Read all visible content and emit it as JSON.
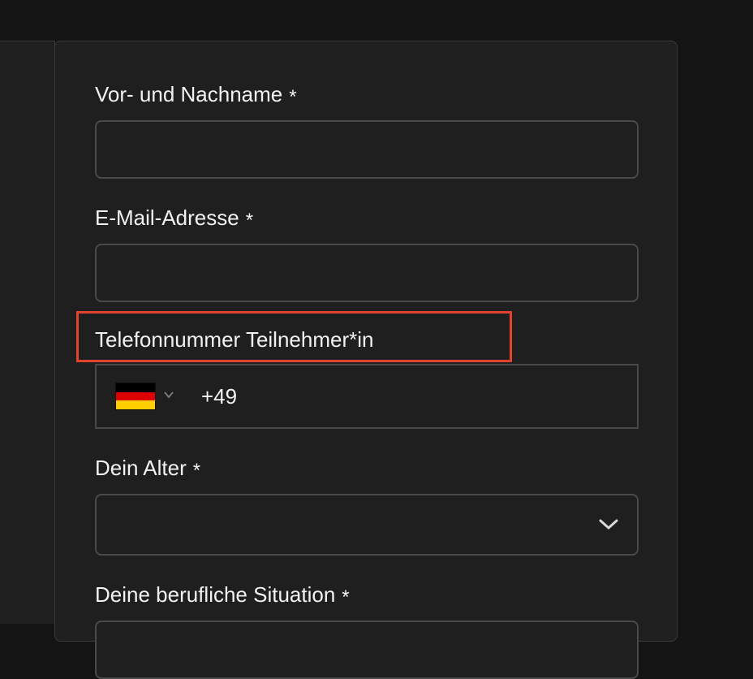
{
  "form": {
    "full_name": {
      "label": "Vor- und Nachname",
      "required_mark": "*",
      "value": ""
    },
    "email": {
      "label": "E-Mail-Adresse",
      "required_mark": "*",
      "value": ""
    },
    "phone": {
      "label": "Telefonnummer Teilnehmer*in",
      "country_flag_icon": "germany-flag-icon",
      "country_flag_colors": [
        "#000000",
        "#dd0000",
        "#ffce00"
      ],
      "dial_code": "+49"
    },
    "age": {
      "label": "Dein Alter",
      "required_mark": "*",
      "selected_value": ""
    },
    "job_situation": {
      "label": "Deine berufliche Situation",
      "required_mark": "*"
    }
  },
  "colors": {
    "highlight": "#e1432f",
    "background": "#141414",
    "card": "#1f1f1f",
    "border": "#4a4a4a",
    "text": "#f2f2f2"
  }
}
